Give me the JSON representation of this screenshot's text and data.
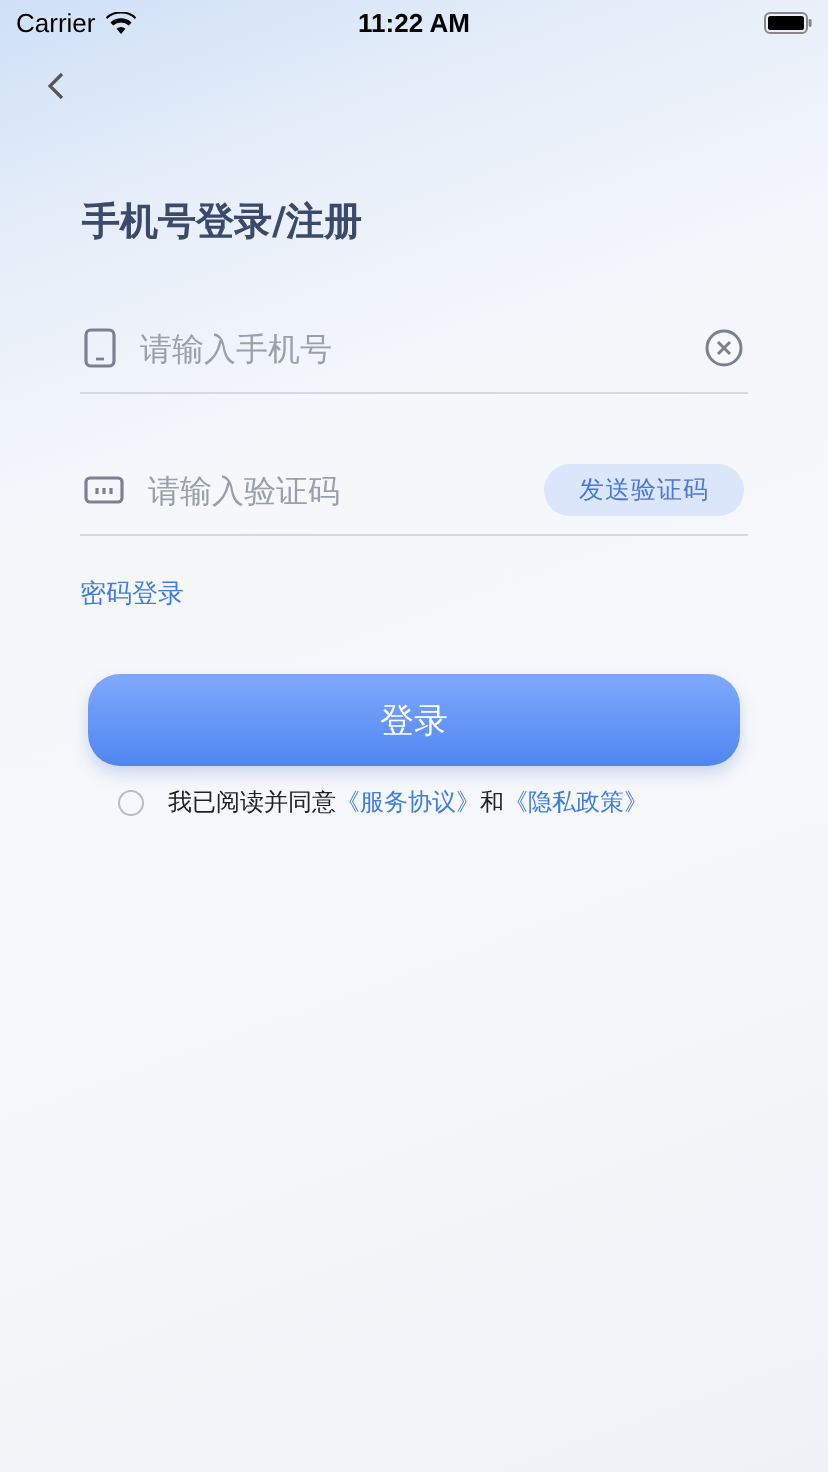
{
  "status_bar": {
    "carrier": "Carrier",
    "time": "11:22 AM"
  },
  "title": "手机号登录/注册",
  "phone_field": {
    "placeholder": "请输入手机号"
  },
  "code_field": {
    "placeholder": "请输入验证码",
    "send_button": "发送验证码"
  },
  "password_login_link": "密码登录",
  "login_button": "登录",
  "agreement": {
    "checked": false,
    "parts": [
      {
        "kind": "text",
        "text": "我已阅读并同意"
      },
      {
        "kind": "link",
        "text": "《服务协议》"
      },
      {
        "kind": "text",
        "text": "和"
      },
      {
        "kind": "link",
        "text": "《隐私政策》"
      }
    ]
  }
}
